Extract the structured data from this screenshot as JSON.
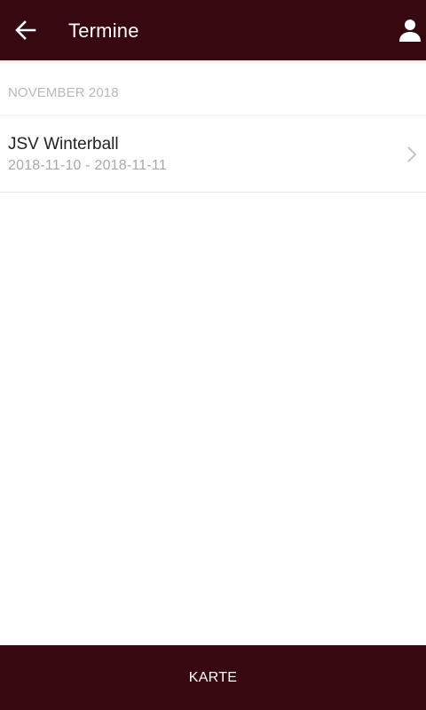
{
  "header": {
    "title": "Termine",
    "back_icon": "arrow-left-icon",
    "user_icon": "person-icon"
  },
  "section": {
    "label": "NOVEMBER 2018"
  },
  "events": [
    {
      "title": "JSV Winterball",
      "dates": "2018-11-10 - 2018-11-11"
    }
  ],
  "bottom_bar": {
    "label": "KARTE"
  },
  "colors": {
    "brand": "#380810",
    "section_text": "#b9b9b9",
    "subtitle_text": "#a8a8a8"
  }
}
